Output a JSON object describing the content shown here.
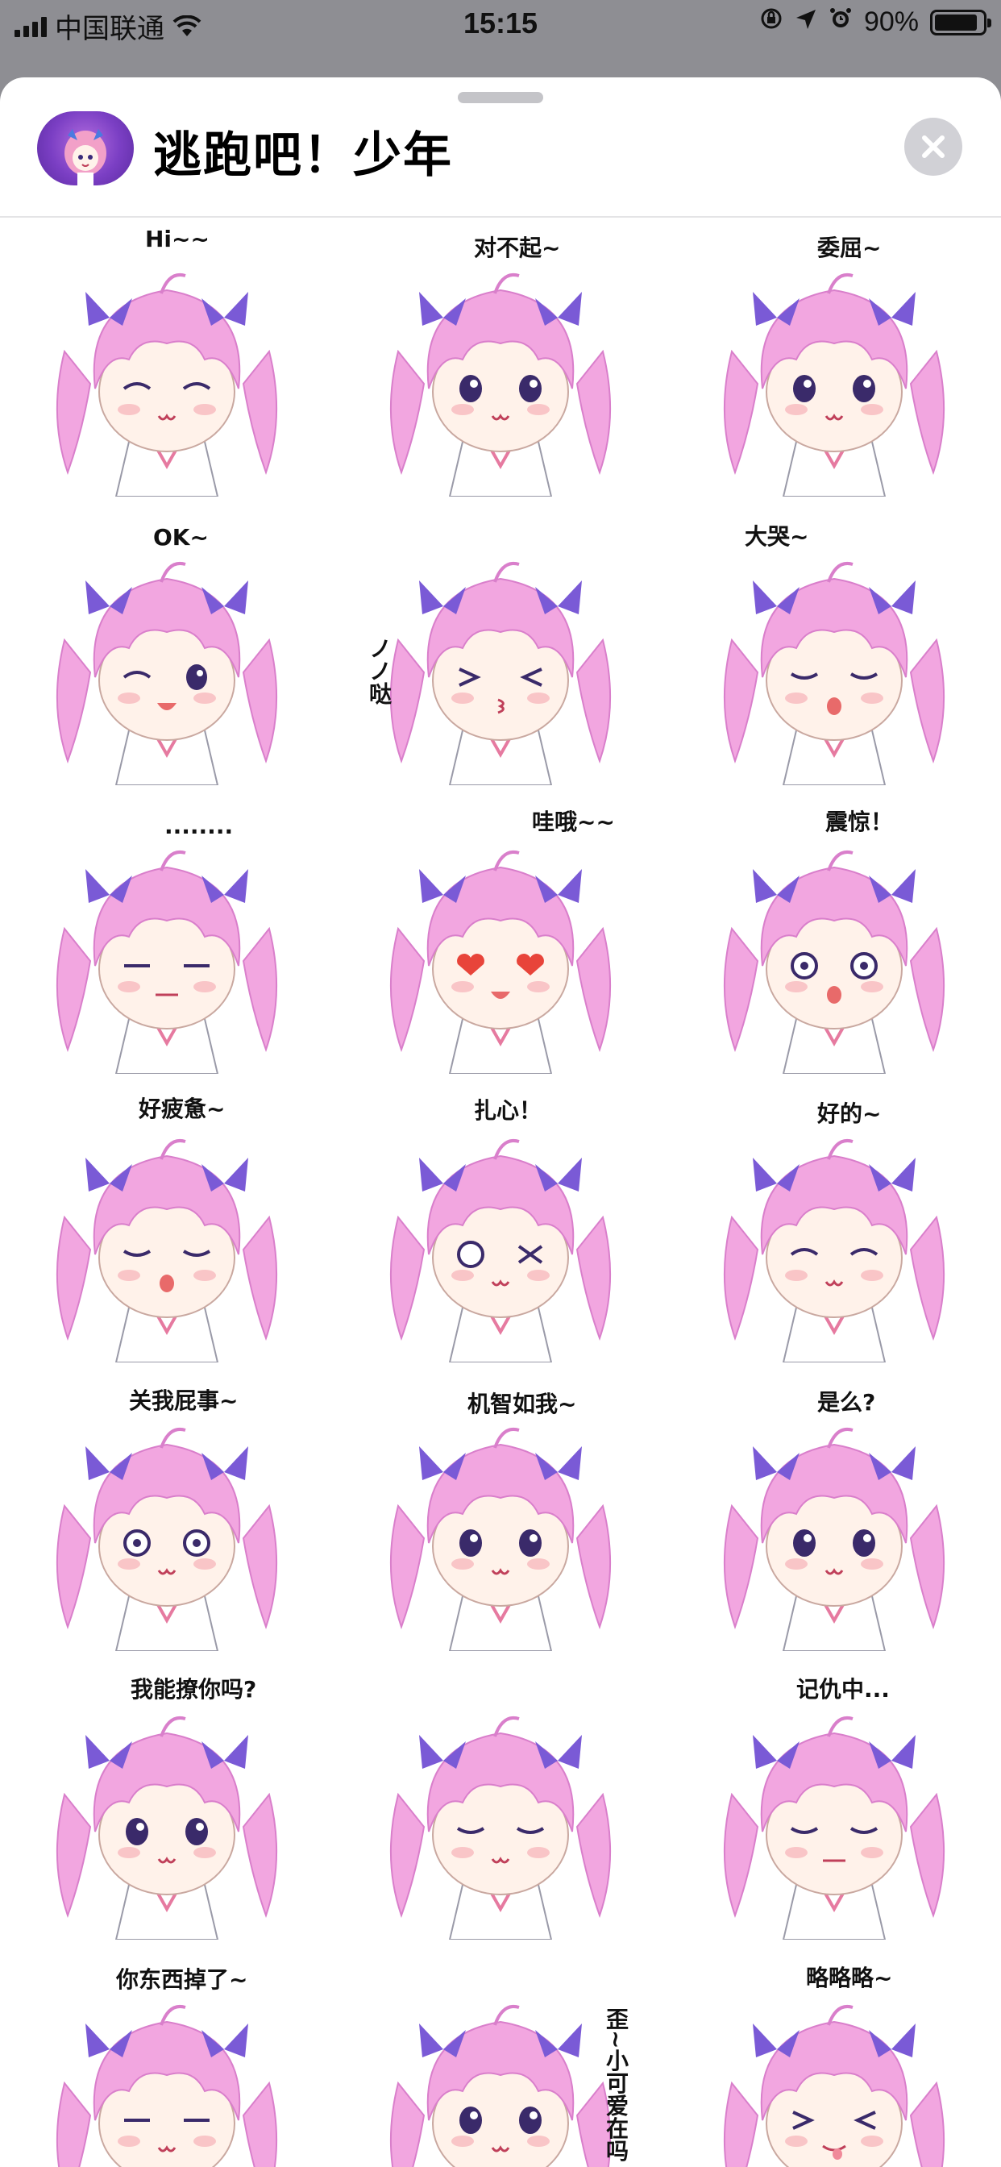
{
  "status_bar": {
    "carrier": "中国联通",
    "time": "15:15",
    "battery_percent": "90%",
    "battery_level": 0.9
  },
  "header": {
    "title": "逃跑吧！少年"
  },
  "colors": {
    "hair": "#f2a6e0",
    "hair_dark": "#d97fcb",
    "bow": "#7a5ad6",
    "skin": "#fff2ea",
    "sheet_bg": "#ffffff",
    "backdrop": "#8e8e93"
  },
  "stickers": [
    {
      "caption": "Hi~~",
      "expression": "shy"
    },
    {
      "caption": "对不起~",
      "expression": "sad"
    },
    {
      "caption": "委屈~",
      "expression": "pout"
    },
    {
      "caption": "OK~",
      "expression": "wink"
    },
    {
      "caption": "ノノ哒",
      "expression": "kiss"
    },
    {
      "caption": "大哭~",
      "expression": "cry"
    },
    {
      "caption": "........",
      "expression": "flat"
    },
    {
      "caption": "哇哦~~",
      "expression": "love"
    },
    {
      "caption": "震惊！",
      "expression": "shock"
    },
    {
      "caption": "好疲惫~",
      "expression": "tired"
    },
    {
      "caption": "扎心！",
      "expression": "hurt"
    },
    {
      "caption": "好的~",
      "expression": "happy"
    },
    {
      "caption": "关我屁事~",
      "expression": "blank"
    },
    {
      "caption": "机智如我~",
      "expression": "smug"
    },
    {
      "caption": "是么?",
      "expression": "question"
    },
    {
      "caption": "我能撩你吗?",
      "expression": "rose"
    },
    {
      "caption": "",
      "expression": "sleep"
    },
    {
      "caption": "记仇中...",
      "expression": "grudge"
    },
    {
      "caption": "你东西掉了~",
      "expression": "sly"
    },
    {
      "caption": "歪~小可爱在吗",
      "expression": "phone"
    },
    {
      "caption": "略略略~",
      "expression": "tease"
    }
  ]
}
